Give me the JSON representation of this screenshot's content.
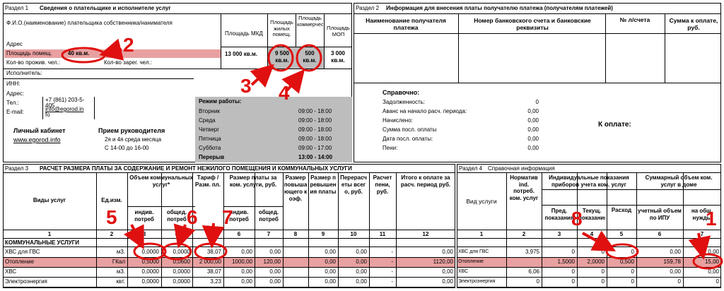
{
  "s1": {
    "title": "Раздел 1",
    "heading": "Сведения о плательщике и исполнителе услуг",
    "fio": "Ф.И.О.(наименование) плательщика собственника/нанимателя",
    "addr": "Адрес",
    "area": "Площадь помещ.",
    "area_val": "40 кв.м.",
    "living": "Кол-во прожив. чел.:",
    "registered": "Кол-во зарег. чел.:",
    "col_mkd": "Площадь МКД",
    "col_res": "Площадь жилых помещ.",
    "col_com": "Площадь коммерческих",
    "col_mop": "Площадь МОП",
    "val_mkd": "13 000 кв.м.",
    "val_res": "9 500 кв.м.",
    "val_com": "500 кв.м.",
    "val_mop": "3 000 кв.м.",
    "executor": "Исполнитель:",
    "inn": "ИНН:",
    "address": "Адрес:",
    "tel": "Тел.:",
    "tel_val": "+7 (861) 203-5-",
    "tel_val2": "405",
    "email": "E-mail:",
    "email_val": "info@egorod.in",
    "email_val2": "fo",
    "cabinet": "Личный кабинет",
    "site": "www.egorod.info",
    "reception": "Прием руководителя",
    "rec1": "2я и 4я среда месяца",
    "rec2": "С 14-00 до 16-00"
  },
  "hours": {
    "title": "Режим работы:",
    "days": [
      {
        "d": "Вторник",
        "t": "09:00 - 18:00"
      },
      {
        "d": "Среда",
        "t": "09:00 - 18:00"
      },
      {
        "d": "Четверг",
        "t": "09:00 - 18:00"
      },
      {
        "d": "Пятница",
        "t": "09:00 - 18:00"
      },
      {
        "d": "Суббота",
        "t": "09:00 - 17:00"
      },
      {
        "d": "Перерыв",
        "t": "13:00 - 14:00"
      }
    ]
  },
  "s2": {
    "title": "Раздел 2",
    "heading": "Информация для внесения платы получателю платежа (получателям платежей)",
    "h1": "Наименование получателя платежа",
    "h2": "Номер банковского счета и банковские реквизиты",
    "h3": "№ л/счета",
    "h4": "Сумма к оплате, руб.",
    "ref": "Справочно:",
    "rows": [
      {
        "l": "Задолженность:",
        "v": "0"
      },
      {
        "l": "Аванс на начало расч. периода:",
        "v": "0,00"
      },
      {
        "l": "Начислено:",
        "v": "0,00"
      },
      {
        "l": "Сумма посл. оплаты",
        "v": "0,00"
      },
      {
        "l": "Дата посл. оплаты:",
        "v": "0,00"
      },
      {
        "l": "Пени:",
        "v": "0,00"
      }
    ],
    "topay": "К оплате:"
  },
  "s3": {
    "title": "Раздел 3",
    "heading": "РАСЧЕТ РАЗМЕРА ПЛАТЫ ЗА СОДЕРЖАНИЕ И РЕМОНТ НЕЖИЛОГО ПОМЕЩЕНИЯ И КОММУНАЛЬНЫХ УСЛУГИ",
    "h_types": "Виды услуг",
    "h_unit": "Ед.изм.",
    "h_vol": "Объем коммунальных услуг*",
    "h_ind": "индив. потреб",
    "h_gen": "общед. потреб",
    "h_tariff": "Тариф / Разм. пл.",
    "h_pay": "Размер платы за ком. услуги, руб.",
    "h_pind": "индив. потреб",
    "h_pgen": "общед. потреб",
    "h_inc": "Размер повышающего коэф.",
    "h_exc": "Размер превышения платы",
    "h_rec": "Перерасчеты всего, руб.",
    "h_fine": "Расчет пени, руб.",
    "h_total": "Итого к оплате за расч. период руб.",
    "nums": [
      "1",
      "2",
      "3",
      "4",
      "5",
      "6",
      "7",
      "8",
      "9",
      "10",
      "11",
      "12"
    ],
    "group": "КОММУНАЛЬНЫЕ УСЛУГИ",
    "rows": [
      {
        "n": "ХВС для ГВС",
        "u": "м3.",
        "i": "0,0000",
        "g": "0,0000",
        "t": "38,07",
        "p1": "0,00",
        "p2": "0,00",
        "e": "0,00",
        "r": "0,00",
        "f": "-",
        "tot": "0,00"
      },
      {
        "n": "Отопление",
        "u": "ГКал",
        "i": "0,5000",
        "g": "0,0600",
        "t": "2 000,00",
        "p1": "1000,00",
        "p2": "120,00",
        "e": "0,00",
        "r": "0,00",
        "f": "-",
        "tot": "1120,00"
      },
      {
        "n": "ХВС",
        "u": "м3.",
        "i": "0,0000",
        "g": "0,0000",
        "t": "38,07",
        "p1": "0,00",
        "p2": "0,00",
        "e": "0,00",
        "r": "0,00",
        "f": "-",
        "tot": "0,00"
      },
      {
        "n": "Электроэнергия",
        "u": "квт.",
        "i": "0,0000",
        "g": "0,0000",
        "t": "3,23",
        "p1": "0,00",
        "p2": "0,00",
        "e": "0,00",
        "r": "0,00",
        "f": "-",
        "tot": "0,00"
      }
    ]
  },
  "s4": {
    "title": "Раздел 4",
    "heading": "Справочная информация",
    "h_type": "Вид услуги",
    "h_norm": "Норматив ind. потреб. ком. услуг",
    "h_ind": "Индивидуальные показания приборов учета ком. услуг",
    "h_prev": "Пред. показания",
    "h_cur": "Текущ. показания",
    "h_use": "Расход",
    "h_sum": "Суммарный объем ком. услуг в доме",
    "h_acc": "учетный объем по ИПУ",
    "h_gen": "на общ. нужды",
    "nums": [
      "1",
      "2",
      "3",
      "4",
      "5",
      "6",
      "7"
    ],
    "rows": [
      {
        "n": "ХВС для ГВС",
        "norm": "3,975",
        "p": "0",
        "c": "0",
        "use": "0",
        "acc": "0,00",
        "gen": "0,00"
      },
      {
        "n": "Отопление",
        "norm": "",
        "p": "1,5000",
        "c": "2,0000",
        "use": "0,500",
        "acc": "159,78",
        "gen": "15,00"
      },
      {
        "n": "ХВС",
        "norm": "6,06",
        "p": "0",
        "c": "0",
        "use": "0",
        "acc": "0,00",
        "gen": "0,00"
      },
      {
        "n": "Электроэнергия",
        "norm": "0",
        "p": "0",
        "c": "0",
        "use": "0",
        "acc": "0",
        "gen": "0"
      }
    ]
  },
  "marks": [
    "1",
    "2",
    "3",
    "4",
    "5",
    "6",
    "7",
    "8"
  ],
  "colors": {
    "highlight": "#e8a0a0",
    "gray": "#bdbdbd",
    "annotation": "#e01010"
  }
}
